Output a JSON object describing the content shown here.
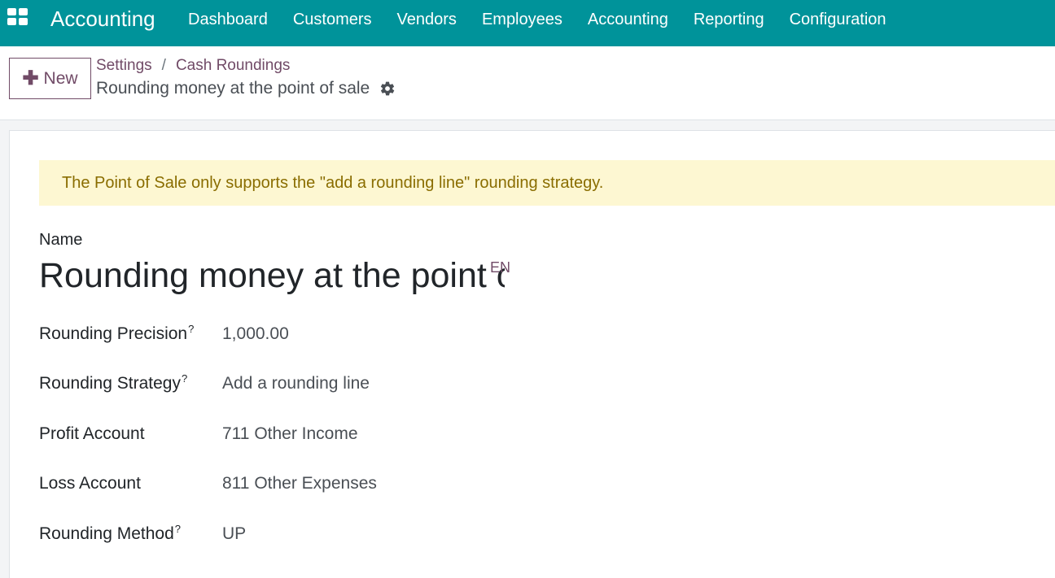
{
  "navbar": {
    "app_name": "Accounting",
    "menu": [
      "Dashboard",
      "Customers",
      "Vendors",
      "Employees",
      "Accounting",
      "Reporting",
      "Configuration"
    ],
    "bg_color": "#00939a"
  },
  "control_panel": {
    "new_label": "New",
    "breadcrumb": [
      "Settings",
      "Cash Roundings"
    ],
    "breadcrumb_separator": "/",
    "record_title": "Rounding money at the point of sale",
    "accent_color": "#714b67"
  },
  "form": {
    "alert": "The Point of Sale only supports the \"add a rounding line\" rounding strategy.",
    "name_label": "Name",
    "name_value": "Rounding money at the point of sale",
    "lang_badge": "EN",
    "help_marker": "?",
    "fields": [
      {
        "label": "Rounding Precision",
        "value": "1,000.00"
      },
      {
        "label": "Rounding Strategy",
        "value": "Add a rounding line"
      },
      {
        "label": "Profit Account",
        "value": "711 Other Income"
      },
      {
        "label": "Loss Account",
        "value": "811 Other Expenses"
      },
      {
        "label": "Rounding Method",
        "value": "UP"
      }
    ]
  }
}
